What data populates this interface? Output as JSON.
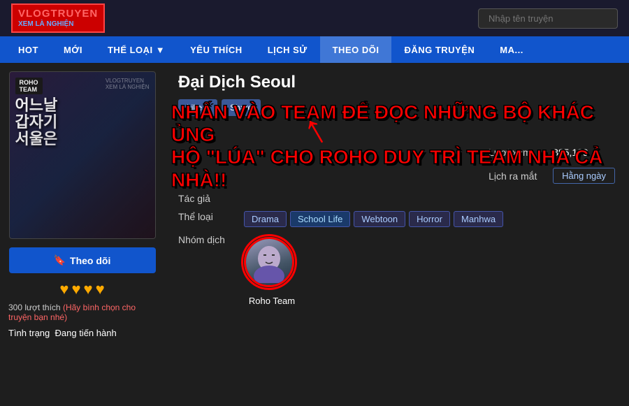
{
  "header": {
    "logo_main": "VLOGTRUYEN",
    "logo_sub": "XEM LÀ NGHIỆN",
    "search_placeholder": "Nhập tên truyện"
  },
  "nav": {
    "items": [
      {
        "label": "HOT"
      },
      {
        "label": "MỚI"
      },
      {
        "label": "THỂ LOẠI ▼"
      },
      {
        "label": "YÊU THÍCH"
      },
      {
        "label": "LỊCH SỬ"
      },
      {
        "label": "THEO DÕI"
      },
      {
        "label": "ĐĂNG TRUYỆN"
      },
      {
        "label": "MA..."
      }
    ]
  },
  "left_panel": {
    "cover_title_kr": "어느날 갑자기 서울은",
    "roho_badge": "ROHO\nTEAM",
    "follow_btn": "Theo dõi",
    "stars_count": 4,
    "likes_count": "300 lượt thích",
    "likes_hint": "(Hãy bình chọn cho truyện bạn nhé)",
    "status_label": "Tình trạng",
    "status_value": "Đang tiến hành"
  },
  "right_panel": {
    "manga_title": "Đại Dịch Seoul",
    "btn_like": "Like 0",
    "btn_share": "Share",
    "overlay_text_line1": "NHẤN VÀO TEAM ĐỂ ĐỌC NHỮNG BỘ KHÁC ỦNG",
    "overlay_text_line2": "HỘ \"LÚA\" CHO ROHO DUY TRÌ TEAM NHA CẢ NHÀ!!",
    "tac_gia_label": "Tác giả",
    "tac_gia_value": "",
    "the_loai_label": "Thể loại",
    "tags": [
      "Drama",
      "School Life",
      "Webtoon",
      "Horror",
      "Manhwa"
    ],
    "nhom_dich_label": "Nhóm dịch",
    "team_name": "Roho Team",
    "luot_xem_label": "Lượt xem",
    "luot_xem_value": "385,139",
    "lich_ra_mat_label": "Lịch ra mắt",
    "lich_ra_mat_value": "Hằng ngày"
  }
}
